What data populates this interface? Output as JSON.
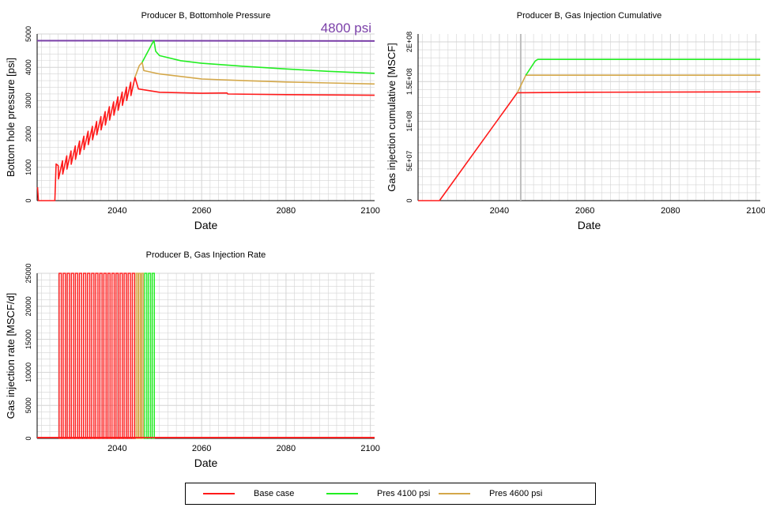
{
  "colors": {
    "base": "#ff1a1a",
    "p4100": "#22ee22",
    "p4600": "#d4a84a",
    "ref": "#7a3fa8",
    "grid": "#d4d4d4",
    "vline": "#bdbdbd"
  },
  "chart_data": [
    {
      "id": "bhp",
      "type": "line",
      "title": "Producer B, Bottomhole Pressure",
      "xlabel": "Date",
      "ylabel": "Bottom hole pressure [psi]",
      "xlim": [
        2021,
        2101
      ],
      "ylim": [
        0,
        5000
      ],
      "xticks": [
        2040,
        2060,
        2080,
        2100
      ],
      "yticks": [
        0,
        1000,
        2000,
        3000,
        4000,
        5000
      ],
      "ytick_labels": [
        "0",
        "1000",
        "2000",
        "3000",
        "4000",
        "5000"
      ],
      "annotation": "4800 psi",
      "reference_line": {
        "y": 4800,
        "x_start": 2021,
        "x_end": 2101,
        "y_end": 4790
      },
      "grid": true,
      "series": [
        {
          "key": "base",
          "name": "Base case",
          "sawtooth": {
            "x_start": 2026,
            "x_end": 2044.2,
            "y_start": 1050,
            "y_end": 3700,
            "cycles": 18,
            "drop": 400
          },
          "points": [
            [
              2021.1,
              400
            ],
            [
              2021.3,
              0
            ],
            [
              2025.2,
              0
            ],
            [
              2025.5,
              1100
            ],
            [
              2026,
              1050
            ],
            [
              2044.2,
              3700
            ],
            [
              2045,
              3350
            ],
            [
              2050,
              3250
            ],
            [
              2060,
              3220
            ],
            [
              2066,
              3230
            ],
            [
              2066.2,
              3200
            ],
            [
              2080,
              3180
            ],
            [
              2101,
              3160
            ]
          ]
        },
        {
          "key": "p4600",
          "name": "Pres 4600 psi",
          "points": [
            [
              2044.2,
              3700
            ],
            [
              2045.2,
              4050
            ],
            [
              2045.9,
              4150
            ],
            [
              2046.3,
              3900
            ],
            [
              2050,
              3800
            ],
            [
              2060,
              3650
            ],
            [
              2070,
              3600
            ],
            [
              2080,
              3560
            ],
            [
              2090,
              3530
            ],
            [
              2101,
              3500
            ]
          ]
        },
        {
          "key": "p4100",
          "name": "Pres 4100 psi",
          "points": [
            [
              2045.9,
              4150
            ],
            [
              2048.2,
              4700
            ],
            [
              2048.7,
              4800
            ],
            [
              2049.1,
              4480
            ],
            [
              2050,
              4350
            ],
            [
              2055,
              4200
            ],
            [
              2060,
              4120
            ],
            [
              2070,
              4030
            ],
            [
              2080,
              3950
            ],
            [
              2090,
              3880
            ],
            [
              2101,
              3820
            ]
          ]
        }
      ]
    },
    {
      "id": "cum",
      "type": "line",
      "title": "Producer B, Gas Injection Cumulative",
      "xlabel": "Date",
      "ylabel": "Gas injection cumulative [MSCF]",
      "xlim": [
        2021,
        2101
      ],
      "ylim": [
        0,
        210000000
      ],
      "xticks": [
        2040,
        2060,
        2080,
        2100
      ],
      "yticks": [
        0,
        50000000,
        100000000,
        150000000,
        200000000
      ],
      "ytick_labels": [
        "0",
        "5E+07",
        "1E+08",
        "1.5E+08",
        "2E+08"
      ],
      "vline_x": 2045,
      "grid": true,
      "series": [
        {
          "key": "base",
          "name": "Base case",
          "points": [
            [
              2021,
              0
            ],
            [
              2026,
              0
            ],
            [
              2044.2,
              136000000
            ],
            [
              2060,
              136500000
            ],
            [
              2101,
              137000000
            ]
          ]
        },
        {
          "key": "p4600",
          "name": "Pres 4600 psi",
          "points": [
            [
              2044.2,
              136000000
            ],
            [
              2046.2,
              158000000
            ],
            [
              2101,
              158000000
            ]
          ]
        },
        {
          "key": "p4100",
          "name": "Pres 4100 psi",
          "points": [
            [
              2046.2,
              158000000
            ],
            [
              2048.4,
              176000000
            ],
            [
              2049,
              178000000
            ],
            [
              2101,
              178000000
            ]
          ]
        }
      ]
    },
    {
      "id": "rate",
      "type": "line",
      "title": "Producer B, Gas Injection Rate",
      "xlabel": "Date",
      "ylabel": "Gas injection rate [MSCF/d]",
      "xlim": [
        2021,
        2101
      ],
      "ylim": [
        0,
        25000
      ],
      "xticks": [
        2040,
        2060,
        2080,
        2100
      ],
      "yticks": [
        0,
        5000,
        10000,
        15000,
        20000,
        25000
      ],
      "ytick_labels": [
        "0",
        "5000",
        "10000",
        "15000",
        "20000",
        "25000"
      ],
      "grid": true,
      "series": [
        {
          "key": "base",
          "name": "Base case",
          "pulses": {
            "x_start": 2026,
            "x_end": 2044.3,
            "count": 19,
            "y": 25000
          }
        },
        {
          "key": "p4600",
          "name": "Pres 4600 psi",
          "pulses": {
            "x_start": 2044.3,
            "x_end": 2046.3,
            "count": 3,
            "y": 25000
          }
        },
        {
          "key": "p4100",
          "name": "Pres 4100 psi",
          "pulses": {
            "x_start": 2046.3,
            "x_end": 2049.0,
            "count": 3,
            "y": 25000
          }
        }
      ]
    }
  ],
  "legend": [
    {
      "key": "base",
      "label": "Base case"
    },
    {
      "key": "p4100",
      "label": "Pres 4100 psi"
    },
    {
      "key": "p4600",
      "label": "Pres 4600 psi"
    }
  ]
}
